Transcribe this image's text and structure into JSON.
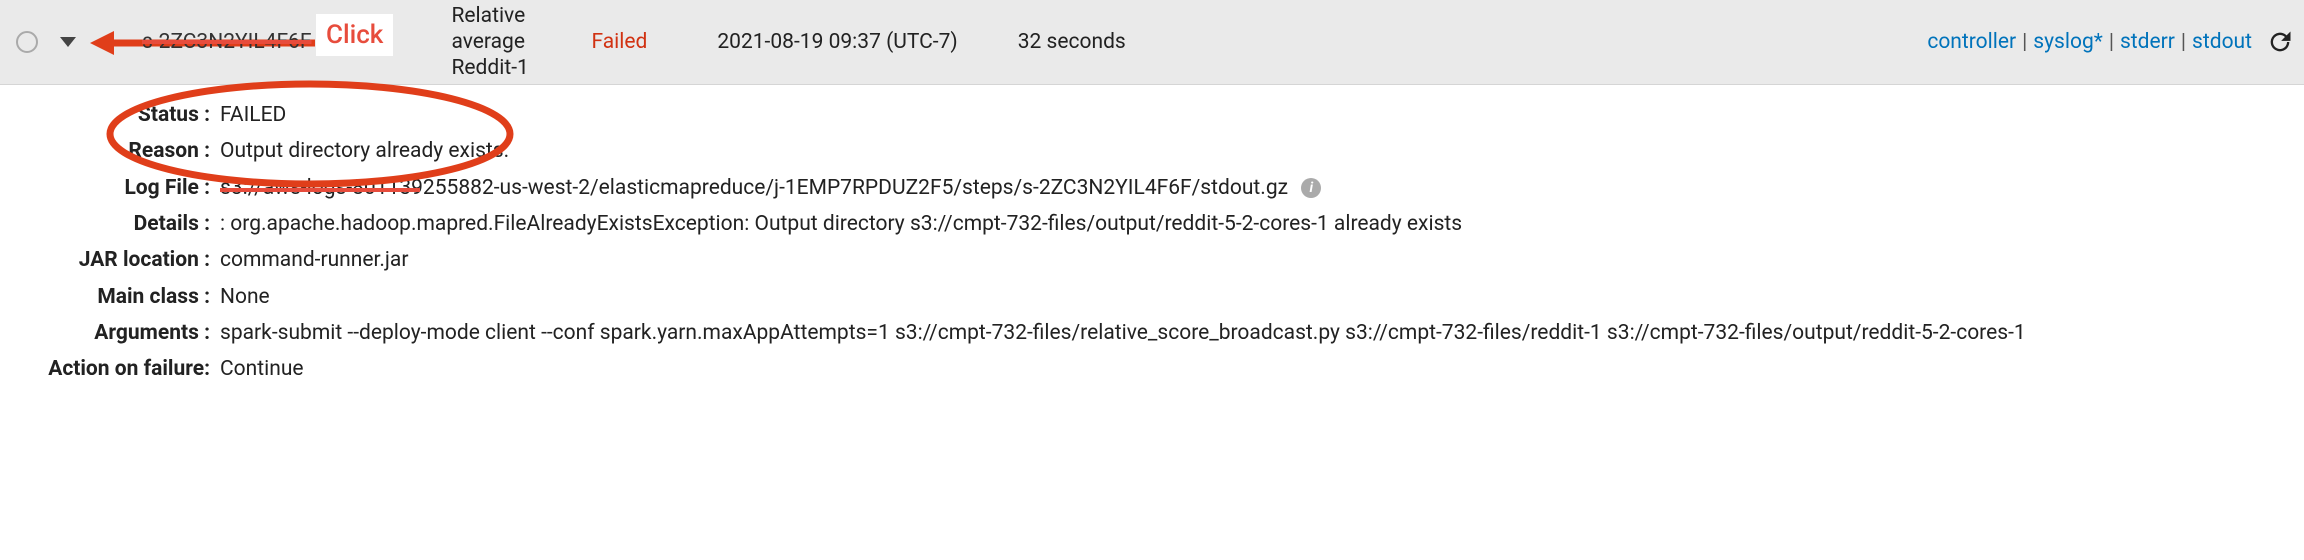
{
  "annotation": {
    "click_label": "Click"
  },
  "row": {
    "step_id": "s-2ZC3N2YIL4F6F",
    "step_name": "Relative average Reddit-1",
    "status": "Failed",
    "timestamp": "2021-08-19 09:37 (UTC-7)",
    "duration": "32 seconds",
    "links": {
      "controller": "controller",
      "syslog": "syslog*",
      "stderr": "stderr",
      "stdout": "stdout"
    }
  },
  "details": {
    "status_label": "Status :",
    "status_value": "FAILED",
    "reason_label": "Reason :",
    "reason_value": "Output directory already exists.",
    "logfile_label": "Log File :",
    "logfile_value": "s3://aws-logs-801139255882-us-west-2/elasticmapreduce/j-1EMP7RPDUZ2F5/steps/s-2ZC3N2YIL4F6F/stdout.gz",
    "details_label": "Details :",
    "details_value": ": org.apache.hadoop.mapred.FileAlreadyExistsException: Output directory s3://cmpt-732-files/output/reddit-5-2-cores-1 already exists",
    "jar_label": "JAR location :",
    "jar_value": "command-runner.jar",
    "mainclass_label": "Main class :",
    "mainclass_value": "None",
    "arguments_label": "Arguments :",
    "arguments_value": "spark-submit --deploy-mode client --conf spark.yarn.maxAppAttempts=1 s3://cmpt-732-files/relative_score_broadcast.py s3://cmpt-732-files/reddit-1 s3://cmpt-732-files/output/reddit-5-2-cores-1",
    "actionfail_label": "Action on failure:",
    "actionfail_value": "Continue"
  }
}
